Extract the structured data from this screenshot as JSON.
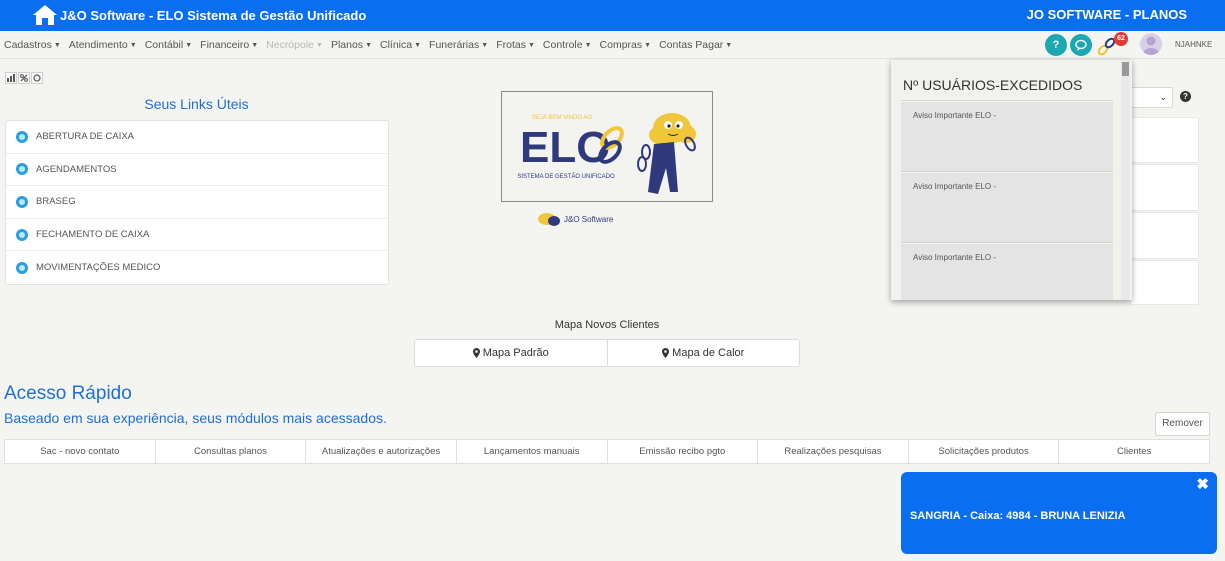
{
  "topbar": {
    "title": "J&O Software - ELO Sistema de Gestão Unificado",
    "right_title": "JO SOFTWARE - PLANOS"
  },
  "menu": [
    {
      "label": "Cadastros",
      "disabled": false
    },
    {
      "label": "Atendimento",
      "disabled": false
    },
    {
      "label": "Contábil",
      "disabled": false
    },
    {
      "label": "Financeiro",
      "disabled": false
    },
    {
      "label": "Necrópole",
      "disabled": true
    },
    {
      "label": "Planos",
      "disabled": false
    },
    {
      "label": "Clínica",
      "disabled": false
    },
    {
      "label": "Funerárias",
      "disabled": false
    },
    {
      "label": "Frotas",
      "disabled": false
    },
    {
      "label": "Controle",
      "disabled": false
    },
    {
      "label": "Compras",
      "disabled": false
    },
    {
      "label": "Contas Pagar",
      "disabled": false
    }
  ],
  "header_icons": {
    "help_glyph": "?",
    "notification_count": "62",
    "username": "NJAHNKE"
  },
  "links": {
    "title": "Seus Links Úteis",
    "items": [
      "ABERTURA DE CAIXA",
      "AGENDAMENTOS",
      "BRASEG",
      "FECHAMENTO DE CAIXA",
      "MOVIMENTAÇÕES MEDICO"
    ]
  },
  "banner": {
    "welcome": "SEJA BEM VINDO AO",
    "logo_text": "ELO",
    "subtitle": "SISTEMA DE GESTÃO UNIFICADO",
    "brand": "J&O Software"
  },
  "map": {
    "title": "Mapa Novos Clientes",
    "buttons": [
      "Mapa Padrão",
      "Mapa de Calor"
    ]
  },
  "quick_access": {
    "title": "Acesso Rápido",
    "subtitle": "Baseado em sua experiência, seus módulos mais acessados.",
    "remove_label": "Remover",
    "items": [
      "Sac - novo contato",
      "Consultas planos",
      "Atualizações e autorizações",
      "Lançamentos manuais",
      "Emissão recibo pgto",
      "Realizações pesquisas",
      "Solicitações produtos",
      "Clientes"
    ]
  },
  "excess_users": {
    "title": "Nº USUÁRIOS-EXCEDIDOS",
    "notices": [
      "Aviso Importante ELO -",
      "Aviso Importante ELO -",
      "Aviso Importante ELO -"
    ]
  },
  "toast": {
    "message": "SANGRIA - Caixa: 4984 - BRUNA LENIZIA"
  },
  "colors": {
    "primary": "#0a6ef0",
    "link_blue": "#1f6fd6",
    "teal": "#1ba8b2",
    "badge_red": "#e53935",
    "logo_navy": "#2f3a7d",
    "logo_yellow": "#f0c63a"
  }
}
